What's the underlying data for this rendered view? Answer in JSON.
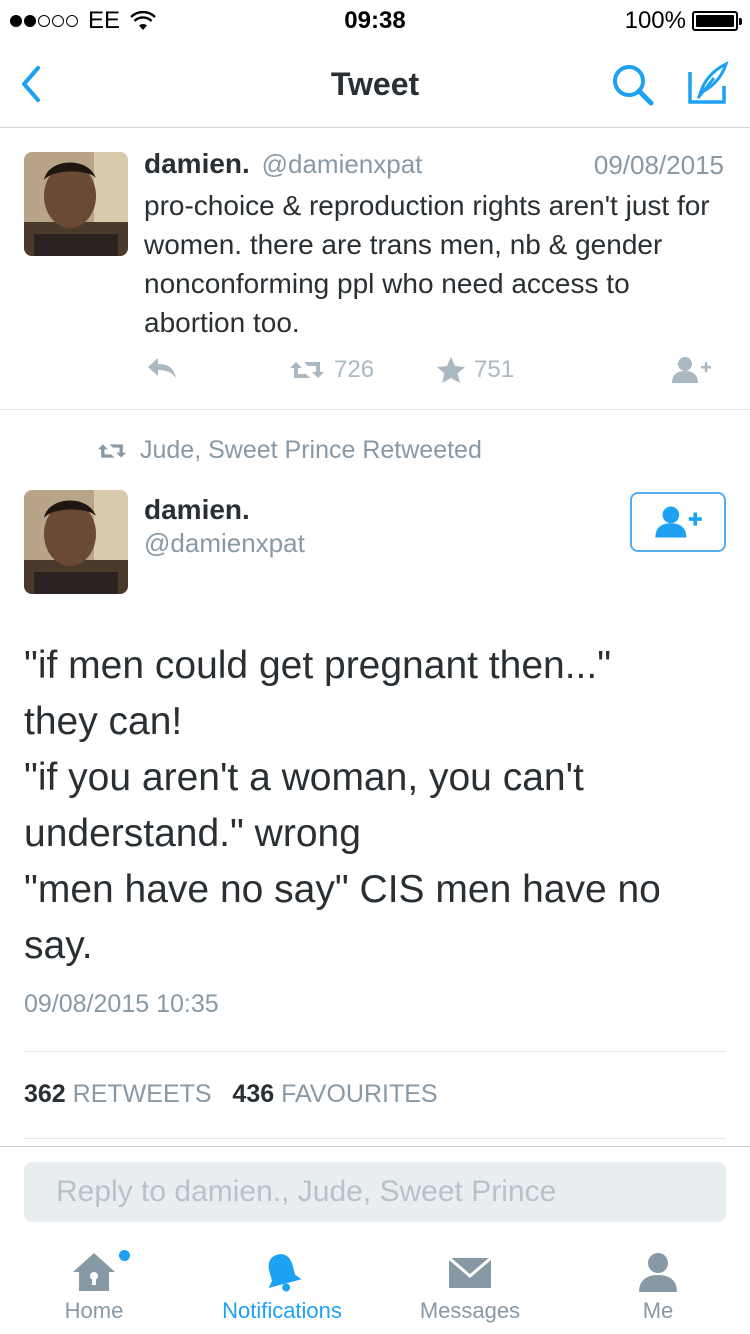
{
  "status_bar": {
    "carrier": "EE",
    "time": "09:38",
    "battery": "100%"
  },
  "nav": {
    "title": "Tweet",
    "back_icon": "chevron-left-icon",
    "search_icon": "search-icon",
    "compose_icon": "compose-icon"
  },
  "tweet1": {
    "name": "damien.",
    "handle": "@damienxpat",
    "date": "09/08/2015",
    "text": "pro-choice & reproduction rights aren't just for women. there are trans men, nb & gender nonconforming ppl who need access to abortion too.",
    "retweets": "726",
    "favourites": "751"
  },
  "retweet_context": "Jude, Sweet Prince Retweeted",
  "main_tweet": {
    "name": "damien.",
    "handle": "@damienxpat",
    "lines": [
      "\"if men could get pregnant then...\"",
      "they can!",
      "\"if you aren't a woman, you can't",
      "understand.\" wrong",
      "\"men have no say\" CIS men have no",
      "say."
    ],
    "timestamp": "09/08/2015 10:35",
    "retweet_count": "362",
    "retweet_label": "RETWEETS",
    "favourite_count": "436",
    "favourite_label": "FAVOURITES"
  },
  "reply": {
    "placeholder": "Reply to damien., Jude, Sweet Prince"
  },
  "tabs": [
    {
      "label": "Home",
      "icon": "home-icon"
    },
    {
      "label": "Notifications",
      "icon": "bell-icon"
    },
    {
      "label": "Messages",
      "icon": "envelope-icon"
    },
    {
      "label": "Me",
      "icon": "person-icon"
    }
  ],
  "colors": {
    "accent": "#1da1f2",
    "text": "#292f33",
    "muted": "#8899a6",
    "icon_muted": "#aab8c2"
  }
}
